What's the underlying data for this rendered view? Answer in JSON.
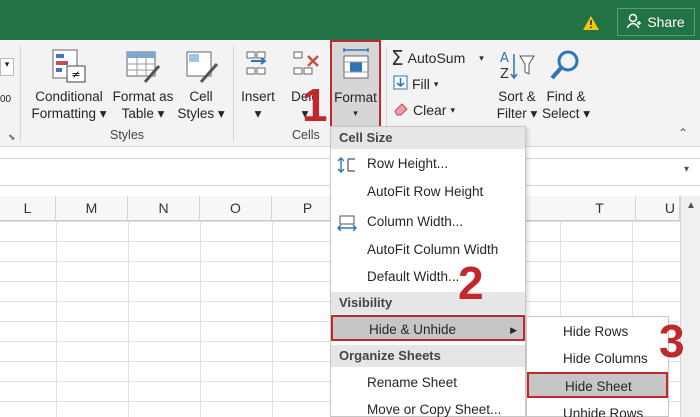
{
  "titlebar": {
    "share_label": "Share",
    "accent": "#217346"
  },
  "ribbon": {
    "styles_group": {
      "label": "Styles",
      "buttons": [
        {
          "line1": "Conditional",
          "line2": "Formatting ▾",
          "icon": "conditional-formatting-icon"
        },
        {
          "line1": "Format as",
          "line2": "Table ▾",
          "icon": "format-as-table-icon"
        },
        {
          "line1": "Cell",
          "line2": "Styles ▾",
          "icon": "cell-styles-icon"
        }
      ]
    },
    "cells_group": {
      "label": "Cells",
      "insert": {
        "line1": "Insert",
        "line2": "▾"
      },
      "delete": {
        "line1": "Dele",
        "line2": "▾"
      },
      "format": {
        "line1": "Format",
        "line2": "▾"
      }
    },
    "editing_group": {
      "autosum": "AutoSum",
      "fill": "Fill",
      "clear": "Clear",
      "sort": {
        "line1": "Sort &",
        "line2": "Filter ▾"
      },
      "find": {
        "line1": "Find &",
        "line2": "Select ▾"
      }
    },
    "left_fragment": "00"
  },
  "columns": [
    "L",
    "M",
    "N",
    "O",
    "P",
    "T",
    "U"
  ],
  "format_menu": {
    "cell_size_header": "Cell Size",
    "row_height": "Row Height...",
    "autofit_row": "AutoFit Row Height",
    "column_width": "Column Width...",
    "autofit_column": "AutoFit Column Width",
    "default_width": "Default Width...",
    "visibility_header": "Visibility",
    "hide_unhide": "Hide & Unhide",
    "organize_header": "Organize Sheets",
    "rename_sheet": "Rename Sheet",
    "move_copy": "Move or Copy Sheet..."
  },
  "hide_submenu": {
    "hide_rows": "Hide Rows",
    "hide_columns": "Hide Columns",
    "hide_sheet": "Hide Sheet",
    "unhide_rows": "Unhide Rows"
  },
  "steps": {
    "s1": "1",
    "s2": "2",
    "s3": "3"
  },
  "highlight_color": "#c0282c"
}
